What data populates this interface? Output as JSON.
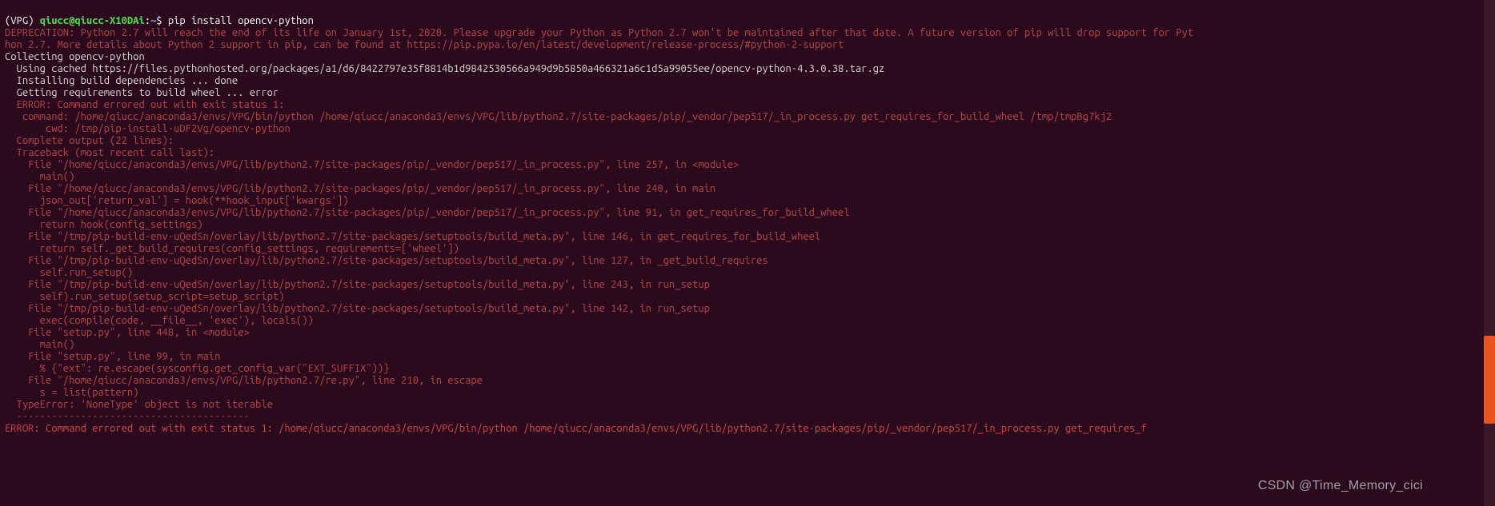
{
  "prompt": {
    "env": "(VPG) ",
    "user_host": "qiucc@qiucc-X10DAi",
    "colon": ":",
    "path": "~",
    "dollar": "$ ",
    "command": "pip install opencv-python"
  },
  "lines": {
    "deprecation1": "DEPRECATION: Python 2.7 will reach the end of its life on January 1st, 2020. Please upgrade your Python as Python 2.7 won't be maintained after that date. A future version of pip will drop support for Pyt",
    "deprecation2": "hon 2.7. More details about Python 2 support in pip, can be found at https://pip.pypa.io/en/latest/development/release-process/#python-2-support",
    "collect": "Collecting opencv-python",
    "cached": "  Using cached https://files.pythonhosted.org/packages/a1/d6/8422797e35f8814b1d9842530566a949d9b5850a466321a6c1d5a99055ee/opencv-python-4.3.0.38.tar.gz",
    "install_deps": "  Installing build dependencies ... done",
    "getreq": "  Getting requirements to build wheel ... error",
    "err_status": "  ERROR: Command errored out with exit status 1:",
    "err_cmd": "   command: /home/qiucc/anaconda3/envs/VPG/bin/python /home/qiucc/anaconda3/envs/VPG/lib/python2.7/site-packages/pip/_vendor/pep517/_in_process.py get_requires_for_build_wheel /tmp/tmpBg7kj2",
    "err_cwd": "       cwd: /tmp/pip-install-uDF2Vg/opencv-python",
    "complete": "  Complete output (22 lines):",
    "traceback": "  Traceback (most recent call last):",
    "f1": "    File \"/home/qiucc/anaconda3/envs/VPG/lib/python2.7/site-packages/pip/_vendor/pep517/_in_process.py\", line 257, in <module>",
    "f1b": "      main()",
    "f2": "    File \"/home/qiucc/anaconda3/envs/VPG/lib/python2.7/site-packages/pip/_vendor/pep517/_in_process.py\", line 240, in main",
    "f2b": "      json_out['return_val'] = hook(**hook_input['kwargs'])",
    "f3": "    File \"/home/qiucc/anaconda3/envs/VPG/lib/python2.7/site-packages/pip/_vendor/pep517/_in_process.py\", line 91, in get_requires_for_build_wheel",
    "f3b": "      return hook(config_settings)",
    "f4": "    File \"/tmp/pip-build-env-uQedSn/overlay/lib/python2.7/site-packages/setuptools/build_meta.py\", line 146, in get_requires_for_build_wheel",
    "f4b": "      return self._get_build_requires(config_settings, requirements=['wheel'])",
    "f5": "    File \"/tmp/pip-build-env-uQedSn/overlay/lib/python2.7/site-packages/setuptools/build_meta.py\", line 127, in _get_build_requires",
    "f5b": "      self.run_setup()",
    "f6": "    File \"/tmp/pip-build-env-uQedSn/overlay/lib/python2.7/site-packages/setuptools/build_meta.py\", line 243, in run_setup",
    "f6b": "      self).run_setup(setup_script=setup_script)",
    "f7": "    File \"/tmp/pip-build-env-uQedSn/overlay/lib/python2.7/site-packages/setuptools/build_meta.py\", line 142, in run_setup",
    "f7b": "      exec(compile(code, __file__, 'exec'), locals())",
    "f8": "    File \"setup.py\", line 448, in <module>",
    "f8b": "      main()",
    "f9": "    File \"setup.py\", line 99, in main",
    "f9b": "      % {\"ext\": re.escape(sysconfig.get_config_var(\"EXT_SUFFIX\"))}",
    "f10": "    File \"/home/qiucc/anaconda3/envs/VPG/lib/python2.7/re.py\", line 210, in escape",
    "f10b": "      s = list(pattern)",
    "typeerr": "  TypeError: 'NoneType' object is not iterable",
    "dashes": "  ----------------------------------------",
    "final": "ERROR: Command errored out with exit status 1: /home/qiucc/anaconda3/envs/VPG/bin/python /home/qiucc/anaconda3/envs/VPG/lib/python2.7/site-packages/pip/_vendor/pep517/_in_process.py get_requires_f"
  },
  "watermark": "CSDN @Time_Memory_cici"
}
